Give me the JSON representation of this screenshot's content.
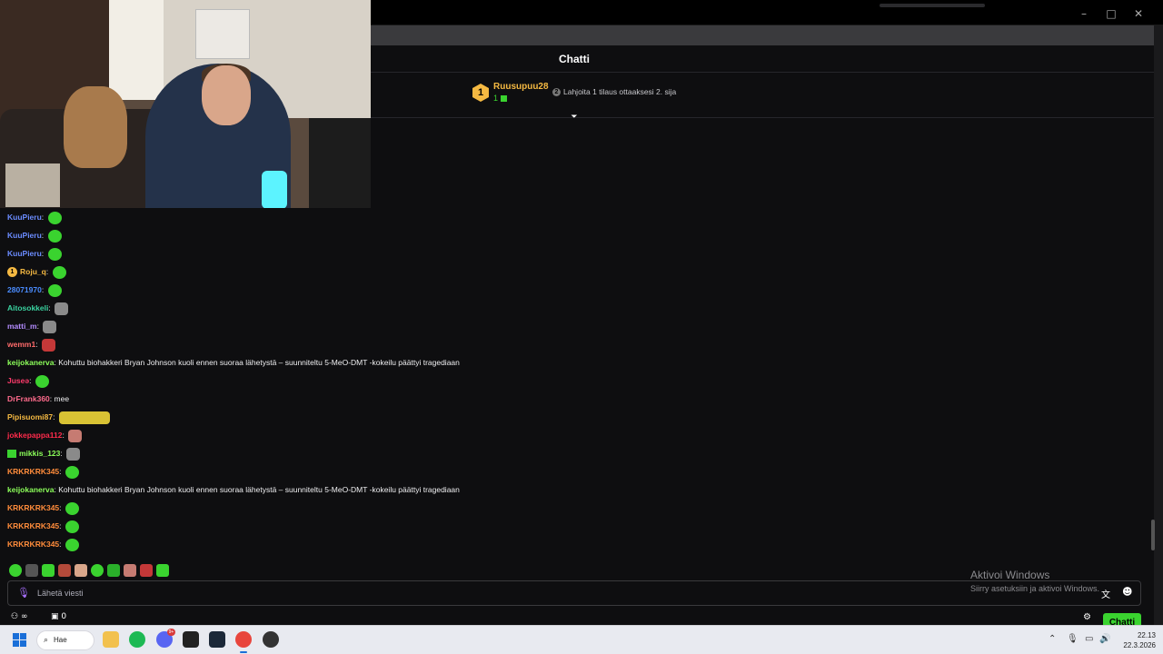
{
  "window": {
    "minimize": "–",
    "maximize": "□",
    "close": "✕"
  },
  "chat": {
    "title": "Chatti",
    "leader": {
      "rank": "1",
      "username": "Ruusupuu28",
      "count": "1",
      "rank2": "2",
      "cta": "Lahjoita 1 tilaus ottaaksesi 2. sija"
    },
    "collapse_icon": "collapse-icon",
    "messages": [
      {
        "user": "KuuPieru",
        "color": "#6b8cff",
        "text": "",
        "emotes": [
          "pepe"
        ]
      },
      {
        "user": "KuuPieru",
        "color": "#6b8cff",
        "text": "",
        "emotes": [
          "pepe"
        ]
      },
      {
        "user": "KuuPieru",
        "color": "#6b8cff",
        "text": "",
        "emotes": [
          "pepe"
        ]
      },
      {
        "user": "Roju_q",
        "color": "#f5b942",
        "badge": "1",
        "text": "",
        "emotes": [
          "pepe"
        ]
      },
      {
        "user": "28071970",
        "color": "#4a8cff",
        "text": "",
        "emotes": [
          "pepe"
        ]
      },
      {
        "user": "Aitosokkeli",
        "color": "#3ad3a0",
        "text": "",
        "emotes": [
          "cat"
        ]
      },
      {
        "user": "matti_m",
        "color": "#b48cff",
        "text": "",
        "emotes": [
          "cat"
        ]
      },
      {
        "user": "wemm1",
        "color": "#ff6b6b",
        "text": "",
        "emotes": [
          "red"
        ]
      },
      {
        "user": "keijokanerva",
        "color": "#8cff5a",
        "text": "Kohuttu biohakkeri Bryan Johnson kuoli ennen suoraa lähetystä – suunniteltu 5-MeO-DMT -kokeilu päättyi tragediaan",
        "emotes": []
      },
      {
        "user": "Juseə",
        "color": "#ff3b6b",
        "text": "",
        "emotes": [
          "pepe"
        ]
      },
      {
        "user": "DrFrank360",
        "color": "#ff6b8c",
        "text": "mee",
        "emotes": []
      },
      {
        "user": "Pipisuomi87",
        "color": "#f5b942",
        "text": "",
        "emotes": [
          "crown"
        ]
      },
      {
        "user": "jokkepappa112",
        "color": "#ff2b4b",
        "text": "",
        "emotes": [
          "face"
        ]
      },
      {
        "user": "mikkis_123",
        "color": "#8cff5a",
        "gift": true,
        "text": "",
        "emotes": [
          "cat"
        ]
      },
      {
        "user": "KRKRKRK345",
        "color": "#ff8c3b",
        "text": "",
        "emotes": [
          "pepe"
        ]
      },
      {
        "user": "keijokanerva",
        "color": "#8cff5a",
        "text": "Kohuttu biohakkeri Bryan Johnson kuoli ennen suoraa lähetystä – suunniteltu 5-MeO-DMT -kokeilu päättyi tragediaan",
        "emotes": []
      },
      {
        "user": "KRKRKRK345",
        "color": "#ff8c3b",
        "text": "",
        "emotes": [
          "pepe"
        ]
      },
      {
        "user": "KRKRKRK345",
        "color": "#ff8c3b",
        "text": "",
        "emotes": [
          "pepe"
        ]
      },
      {
        "user": "KRKRKRK345",
        "color": "#ff8c3b",
        "text": "",
        "emotes": [
          "pepe"
        ]
      }
    ],
    "input_placeholder": "Lähetä viesti",
    "viewers": "∞",
    "points": "0",
    "send_label": "Chatti"
  },
  "watermark": {
    "line1": "Aktivoi Windows",
    "line2": "Siirry asetuksiin ja aktivoi Windows."
  },
  "taskbar": {
    "search_label": "Hae",
    "discord_badge": "9+",
    "clock_time": "22.13",
    "clock_date": "22.3.2026"
  },
  "colors": {
    "accent": "#3ad32f",
    "background": "#0e0e10",
    "gold": "#f5b942"
  }
}
